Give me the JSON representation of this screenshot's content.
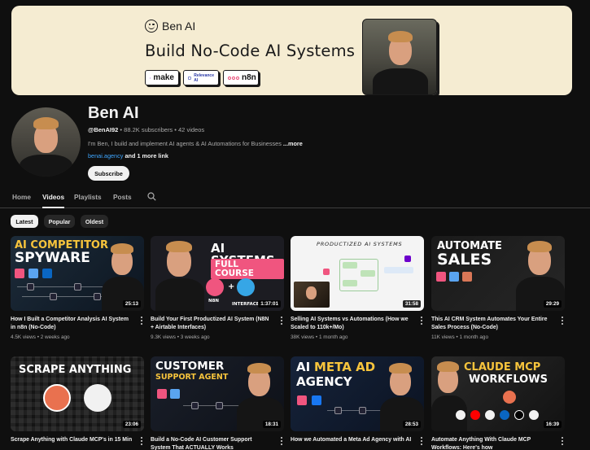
{
  "banner": {
    "brand_name": "Ben AI",
    "headline": "Build No-Code AI Systems",
    "partners": [
      "make",
      "Relevance AI",
      "n8n"
    ]
  },
  "channel": {
    "name": "Ben AI",
    "handle": "@BenAI92",
    "subscribers": "88.2K subscribers",
    "videos_count": "42 videos",
    "separator": "•",
    "description": "I'm Ben, I build and implement AI agents & AI Automations for Businesses",
    "more_label": "...more",
    "link": "benai.agency",
    "more_links": "and 1 more link",
    "subscribe_label": "Subscribe"
  },
  "tabs": [
    "Home",
    "Videos",
    "Playlists",
    "Posts"
  ],
  "active_tab": "Videos",
  "chips": [
    "Latest",
    "Popular",
    "Oldest"
  ],
  "active_chip": "Latest",
  "colors": {
    "background": "#0f0f0f",
    "banner": "#f5ecd2",
    "link_blue": "#3ea6ff",
    "thumb_yellow": "#f7c43c",
    "thumb_pink": "#f0557f"
  },
  "thumbnails_text": {
    "v1": [
      "AI COMPETITOR",
      "SPYWARE"
    ],
    "v2": [
      "AI SYSTEMS",
      "FULL COURSE",
      "N8N",
      "INTERFACE..."
    ],
    "v3": [
      "PRODUCTIZED AI SYSTEMS"
    ],
    "v4": [
      "AUTOMATE",
      "SALES"
    ],
    "v5": [
      "SCRAPE ANYTHING"
    ],
    "v6": [
      "CUSTOMER",
      "SUPPORT AGENT"
    ],
    "v7": [
      "AI",
      "META AD",
      "AGENCY"
    ],
    "v8": [
      "CLAUDE MCP",
      "WORKFLOWS"
    ]
  },
  "videos": [
    {
      "title": "How I Built a Competitor Analysis AI System in n8n (No-Code)",
      "views": "4.5K views",
      "age": "2 weeks ago",
      "duration": "25:13"
    },
    {
      "title": "Build Your First Productized AI System (N8N + Airtable Interfaces)",
      "views": "9.3K views",
      "age": "3 weeks ago",
      "duration": "1:37:01"
    },
    {
      "title": "Selling AI Systems vs Automations (How we Scaled to 110k+/Mo)",
      "views": "38K views",
      "age": "1 month ago",
      "duration": "31:58"
    },
    {
      "title": "This AI CRM System Automates Your Entire Sales Process (No-Code)",
      "views": "11K views",
      "age": "1 month ago",
      "duration": "29:29"
    },
    {
      "title": "Scrape Anything with Claude MCP's in 15 Min",
      "views": "",
      "age": "",
      "duration": "23:06"
    },
    {
      "title": "Build a No-Code AI Customer Support System That ACTUALLY Works",
      "views": "",
      "age": "",
      "duration": "18:31"
    },
    {
      "title": "How we Automated a Meta Ad Agency with AI",
      "views": "",
      "age": "",
      "duration": "28:53"
    },
    {
      "title": "Automate Anything With Claude MCP Workflows: Here's how",
      "views": "",
      "age": "",
      "duration": "16:39"
    }
  ]
}
